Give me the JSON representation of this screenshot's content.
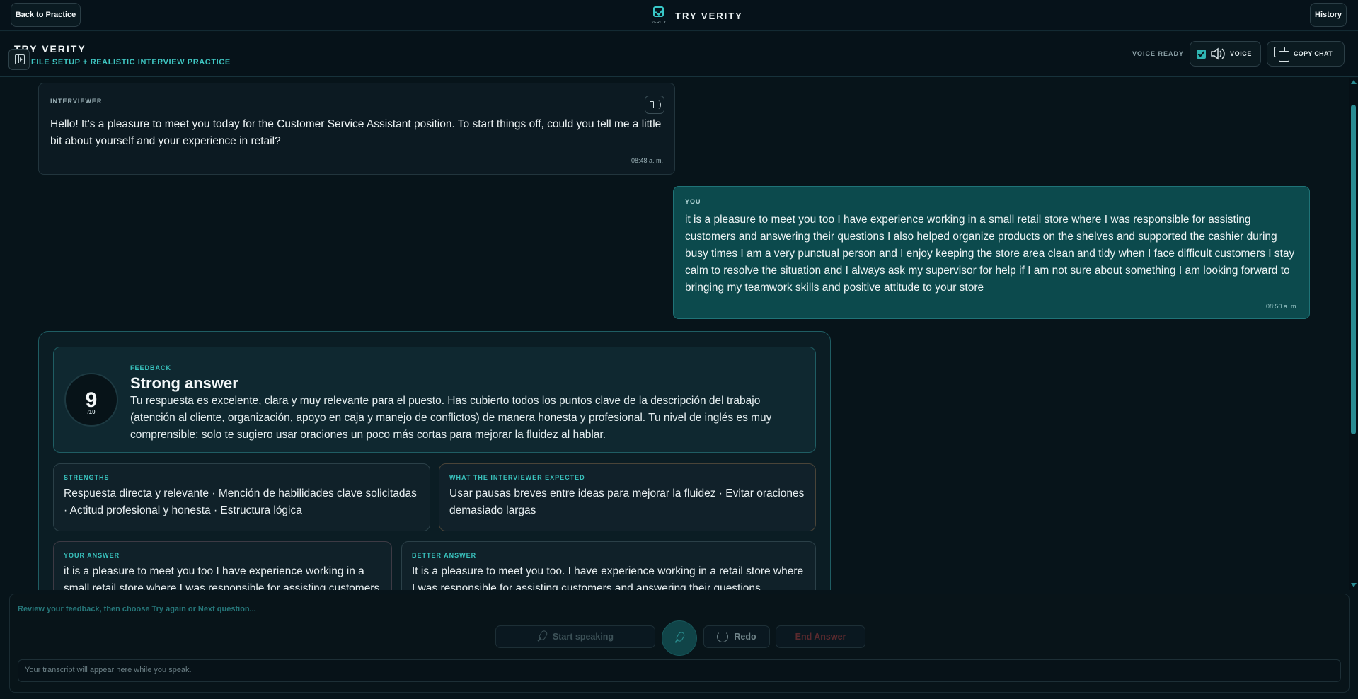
{
  "topbar": {
    "back_label": "Back to Practice",
    "brand_small": "VERITY",
    "brand_title": "TRY VERITY",
    "history_label": "History"
  },
  "subheader": {
    "title": "TRY VERITY",
    "tagline": "FILE SETUP + REALISTIC INTERVIEW PRACTICE",
    "voice_ready": "VOICE READY",
    "voice_label": "VOICE",
    "copy_label": "COPY CHAT"
  },
  "messages": {
    "interviewer": {
      "label": "INTERVIEWER",
      "text": "Hello! It’s a pleasure to meet you today for the Customer Service Assistant position. To start things off, could you tell me a little bit about yourself and your experience in retail?",
      "time": "08:48 a. m."
    },
    "you": {
      "label": "YOU",
      "text": "it is a pleasure to meet you too I have experience working in a small retail store where I was responsible for assisting customers and answering their questions I also helped organize products on the shelves and supported the cashier during busy times I am a very punctual person and I enjoy keeping the store area clean and tidy when I face difficult customers I stay calm to resolve the situation and I always ask my supervisor for help if I am not sure about something I am looking forward to bringing my teamwork skills and positive attitude to your store",
      "time": "08:50 a. m."
    }
  },
  "feedback": {
    "score": "9",
    "score_den": "/10",
    "label": "FEEDBACK",
    "headline": "Strong answer",
    "summary": "Tu respuesta es excelente, clara y muy relevante para el puesto. Has cubierto todos los puntos clave de la descripción del trabajo (atención al cliente, organización, apoyo en caja y manejo de conflictos) de manera honesta y profesional. Tu nivel de inglés es muy comprensible; solo te sugiero usar oraciones un poco más cortas para mejorar la fluidez al hablar.",
    "strengths_label": "STRENGTHS",
    "strengths_text": "Respuesta directa y relevante · Mención de habilidades clave solicitadas · Actitud profesional y honesta · Estructura lógica",
    "expected_label": "WHAT THE INTERVIEWER EXPECTED",
    "expected_text": "Usar pausas breves entre ideas para mejorar la fluidez · Evitar oraciones demasiado largas",
    "your_answer_label": "YOUR ANSWER",
    "your_answer_text": "it is a pleasure to meet you too I have experience working in a small retail store where I was responsible for assisting customers and answering their questions",
    "better_answer_label": "BETTER ANSWER",
    "better_answer_text": "It is a pleasure to meet you too. I have experience working in a retail store where I was responsible for assisting customers and answering their questions."
  },
  "composer": {
    "hint": "Review your feedback, then choose Try again or Next question...",
    "start_label": "Start speaking",
    "redo_label": "Redo",
    "end_label": "End Answer",
    "transcript_placeholder": "Your transcript will appear here while you speak."
  },
  "colors": {
    "accent": "#39c3be",
    "you_bubble": "#0c4a4d",
    "background": "#07141a",
    "end_answer": "#5a2a2e"
  }
}
